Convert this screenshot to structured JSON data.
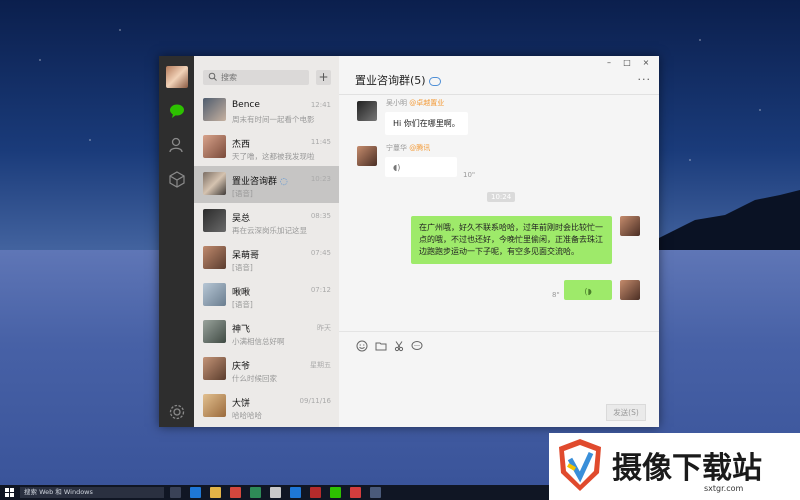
{
  "taskbar": {
    "search_placeholder": "搜索 Web 和 Windows"
  },
  "window": {
    "search_placeholder": "搜索",
    "add_label": "+",
    "controls": {
      "minimize": "–",
      "maximize": "□",
      "close": "×"
    }
  },
  "conversations": [
    {
      "name": "Bence",
      "message": "周末有时间一起看个电影",
      "time": "12:41"
    },
    {
      "name": "杰西",
      "message": "天了噜，这都被我发现啦",
      "time": "11:45"
    },
    {
      "name": "置业咨询群",
      "message": "[语音]",
      "time": "10:23"
    },
    {
      "name": "吴总",
      "message": "再在云深岗乐加记这显",
      "time": "08:35"
    },
    {
      "name": "呆萌哥",
      "message": "[语音]",
      "time": "07:45"
    },
    {
      "name": "啾啾",
      "message": "[语音]",
      "time": "07:12"
    },
    {
      "name": "神飞",
      "message": "小满相信总好啊",
      "time": "昨天"
    },
    {
      "name": "庆爷",
      "message": "什么时候回家",
      "time": "星期五"
    },
    {
      "name": "大饼",
      "message": "哈哈哈哈",
      "time": "09/11/16"
    }
  ],
  "chat": {
    "title": "置业咨询群(5)",
    "more_label": "···",
    "messages": [
      {
        "sender": "吴小明",
        "tag": "@卓越置业",
        "text": "Hi 你们在哪里啊。"
      },
      {
        "sender": "宁蔓华",
        "tag": "@腾讯",
        "voice_duration": "10\""
      },
      {
        "text": "在广州哦，好久不联系哈哈，过年前刚时会比较忙一点的哦，不过也还好，今晚忙里偷闲，正准备去珠江边跑跑步运动一下子呢，有空多见面交流哈。"
      },
      {
        "voice_duration": "8\""
      }
    ],
    "time_chip": "10:24",
    "send_label": "发送(S)"
  },
  "watermark": {
    "text": "摄像下载站",
    "url": "sxtgr.com"
  }
}
